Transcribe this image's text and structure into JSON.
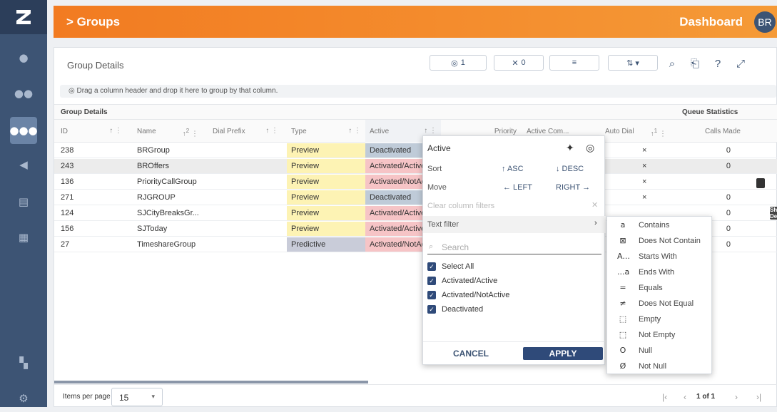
{
  "header": {
    "title": "> Groups",
    "dashboard": "Dashboard",
    "avatar": "BR"
  },
  "panel": {
    "title": "Group Details"
  },
  "toolbar": {
    "hidden_count": "1",
    "pinned_count": "0"
  },
  "group_hint": "Drag a column header and drop it here to group by that column.",
  "column_groups": {
    "group_details": "Group Details",
    "queue_statistics": "Queue Statistics"
  },
  "columns": {
    "id": "ID",
    "name": "Name",
    "dial_prefix": "Dial Prefix",
    "type": "Type",
    "active": "Active",
    "priority": "Priority",
    "active_com": "Active Com...",
    "auto_dial": "Auto Dial",
    "calls_made": "Calls Made",
    "name_sort_index": "2",
    "auto_sort_index": "1"
  },
  "rows": [
    {
      "id": "238",
      "name": "BRGroup",
      "type": "Preview",
      "active": "Deactivated",
      "auto": "×",
      "calls": "0"
    },
    {
      "id": "243",
      "name": "BROffers",
      "type": "Preview",
      "active": "Activated/Active",
      "auto": "×",
      "calls": "0"
    },
    {
      "id": "136",
      "name": "PriorityCallGroup",
      "type": "Preview",
      "active": "Activated/NotActive",
      "auto": "×",
      "calls": ""
    },
    {
      "id": "271",
      "name": "RJGROUP",
      "type": "Preview",
      "active": "Deactivated",
      "auto": "×",
      "calls": "0"
    },
    {
      "id": "124",
      "name": "SJCityBreaksGr...",
      "type": "Preview",
      "active": "Activated/Active",
      "auto": "",
      "calls": "0"
    },
    {
      "id": "156",
      "name": "SJToday",
      "type": "Preview",
      "active": "Activated/Active",
      "auto": "",
      "calls": "0"
    },
    {
      "id": "27",
      "name": "TimeshareGroup",
      "type": "Predictive",
      "active": "Activated/NotActive",
      "auto": "",
      "calls": "0"
    }
  ],
  "tooltip": "Show Details",
  "column_menu": {
    "title": "Active",
    "sort_label": "Sort",
    "asc": "↑ ASC",
    "desc": "↓ DESC",
    "move_label": "Move",
    "left": "← LEFT",
    "right": "RIGHT →",
    "clear_filters": "Clear column filters",
    "text_filter": "Text filter",
    "search_placeholder": "Search",
    "options": [
      "Select All",
      "Activated/Active",
      "Activated/NotActive",
      "Deactivated"
    ],
    "cancel": "CANCEL",
    "apply": "APPLY"
  },
  "filter_types": [
    {
      "icon": "a",
      "label": "Contains"
    },
    {
      "icon": "⊠",
      "label": "Does Not Contain"
    },
    {
      "icon": "A...",
      "label": "Starts With"
    },
    {
      "icon": "...a",
      "label": "Ends With"
    },
    {
      "icon": "=",
      "label": "Equals"
    },
    {
      "icon": "≠",
      "label": "Does Not Equal"
    },
    {
      "icon": "⬚",
      "label": "Empty"
    },
    {
      "icon": "⬚",
      "label": "Not Empty"
    },
    {
      "icon": "O",
      "label": "Null"
    },
    {
      "icon": "Ø",
      "label": "Not Null"
    }
  ],
  "footer": {
    "items_per_page_label": "Items per page",
    "items_per_page": "15",
    "page_info": "1 of 1"
  },
  "colors": {
    "accent": "#f27b21",
    "nav": "#3d5474",
    "preview": "#fdf3b4",
    "predictive": "#c9ccd9",
    "deactivated": "#bfcbd8",
    "activated": "#f6c4c6",
    "apply": "#2f4a79"
  }
}
